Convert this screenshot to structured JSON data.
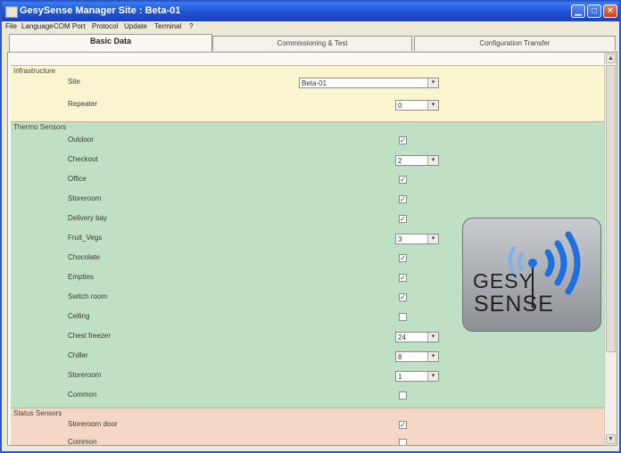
{
  "window": {
    "title": "GesySense Manager  Site : Beta-01"
  },
  "menu": [
    "File",
    "Language",
    "COM Port",
    "Protocol",
    "Update",
    "Terminal",
    "?"
  ],
  "tabs": [
    "Basic Data",
    "Commissioning & Test",
    "Configuration Transfer"
  ],
  "infrastructure": {
    "title": "Infrastructure",
    "site_label": "Site",
    "site_value": "Beta-01",
    "repeater_label": "Repeater",
    "repeater_value": "0"
  },
  "thermo": {
    "title": "Thermo Sensors",
    "rows": [
      {
        "label": "Outdoor",
        "control": "checkbox",
        "checked": true
      },
      {
        "label": "Checkout",
        "control": "select",
        "value": "2"
      },
      {
        "label": "Office",
        "control": "checkbox",
        "checked": true
      },
      {
        "label": "Storeroom",
        "control": "checkbox",
        "checked": true
      },
      {
        "label": "Delivery bay",
        "control": "checkbox",
        "checked": true
      },
      {
        "label": "Fruit_Vegs",
        "control": "select",
        "value": "3"
      },
      {
        "label": "Chocolate",
        "control": "checkbox",
        "checked": true
      },
      {
        "label": "Empties",
        "control": "checkbox",
        "checked": true
      },
      {
        "label": "Switch room",
        "control": "checkbox",
        "checked": true
      },
      {
        "label": "Ceiling",
        "control": "checkbox",
        "checked": false
      },
      {
        "label": "Chest freezer",
        "control": "select",
        "value": "24"
      },
      {
        "label": "Chiller",
        "control": "select",
        "value": "8"
      },
      {
        "label": "Storeroom",
        "control": "select",
        "value": "1"
      },
      {
        "label": "Common",
        "control": "checkbox",
        "checked": false
      }
    ]
  },
  "status": {
    "title": "Status Sensors",
    "rows": [
      {
        "label": "Storeroom door",
        "control": "checkbox",
        "checked": true
      },
      {
        "label": "Common",
        "control": "checkbox",
        "checked": false
      }
    ]
  },
  "logo": {
    "line1": "GESY",
    "line2": "SENSE"
  },
  "icons": {
    "checkmark": "✓",
    "dropdown": "▾",
    "scroll_up": "▲",
    "scroll_down": "▼"
  },
  "colors": {
    "infra_bg": "#fbf5cf",
    "thermo_bg": "#bfe0c4",
    "status_bg": "#f5d7c5",
    "logo_wave": "#1e6fe0"
  }
}
